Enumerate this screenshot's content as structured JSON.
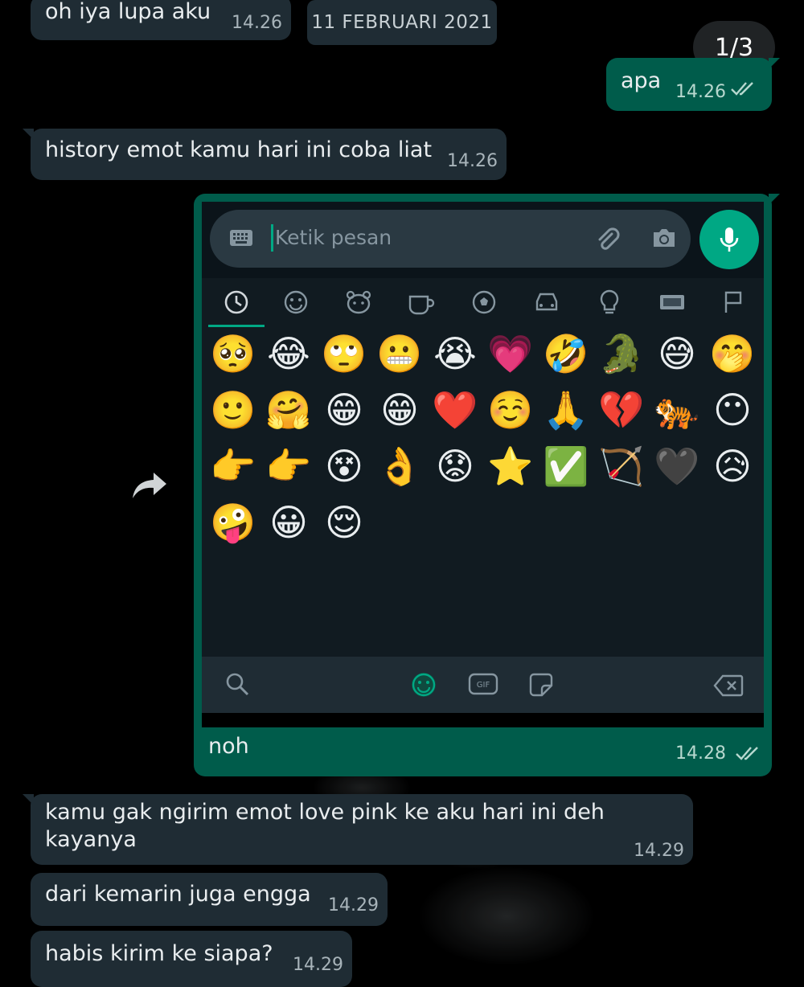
{
  "counter": "1/3",
  "date_chip": "11 FEBRUARI 2021",
  "messages": [
    {
      "text": "oh iya lupa aku",
      "time": "14.26"
    },
    {
      "text": "apa",
      "time": "14.26"
    },
    {
      "text": "history emot kamu hari ini coba liat",
      "time": "14.26"
    },
    {
      "text": "noh",
      "time": "14.28"
    },
    {
      "text": "kamu gak ngirim emot love pink ke aku hari ini deh kayanya",
      "time": "14.29"
    },
    {
      "text": "dari kemarin juga engga",
      "time": "14.29"
    },
    {
      "text": "habis kirim ke siapa?",
      "time": "14.29"
    }
  ],
  "screenshot": {
    "placeholder": "Ketik pesan",
    "tabs": [
      "clock-icon",
      "smiley-icon",
      "animal-icon",
      "food-icon",
      "ball-icon",
      "car-icon",
      "bulb-icon",
      "symbols-icon",
      "flag-icon"
    ],
    "emojis": [
      [
        "🥺",
        "😂",
        "🙄",
        "😬",
        "😭",
        "💗",
        "🤣",
        "🐊",
        "😅",
        "🤭"
      ],
      [
        "🙂",
        "🤗",
        "😁",
        "😁",
        "❤️",
        "☺️",
        "🙏",
        "💔",
        "🐅",
        "😶"
      ],
      [
        "👉",
        "👉",
        "😵",
        "👌",
        "😟",
        "⭐",
        "✅",
        "🏹",
        "🖤",
        "😥"
      ],
      [
        "🤪",
        "😀",
        "😌"
      ]
    ],
    "bottom": [
      "search-icon",
      "emoji-icon",
      "gif-icon",
      "sticker-icon",
      "backspace-icon"
    ],
    "gif_label": "GIF"
  },
  "colors": {
    "incoming": "#1f2c34",
    "outgoing": "#005c4b",
    "accent": "#00a884"
  }
}
